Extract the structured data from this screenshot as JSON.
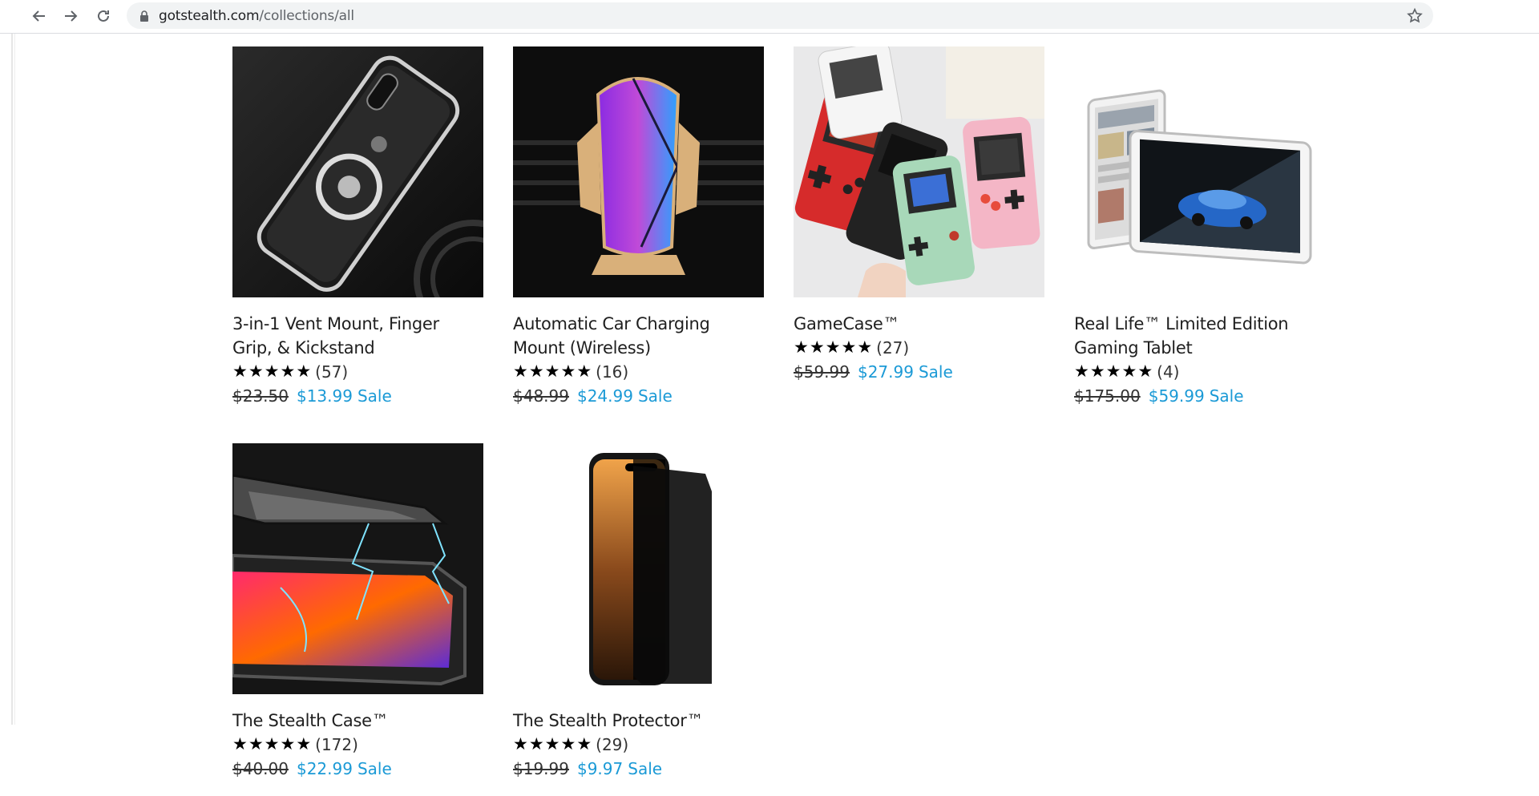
{
  "browser": {
    "url_domain": "gotstealth.com",
    "url_path": "/collections/all",
    "back_icon": "arrow-left-icon",
    "forward_icon": "arrow-right-icon",
    "reload_icon": "reload-icon",
    "bookmark_icon": "star-outline-icon"
  },
  "colors": {
    "sale": "#1b9ad6",
    "stars": "#000000"
  },
  "sale_label": "Sale",
  "products": [
    {
      "title": "3-in-1 Vent Mount, Finger Grip, & Kickstand",
      "rating": 5,
      "reviews": "(57)",
      "old_price": "$23.50",
      "price": "$13.99",
      "image": "phone-ring-holder"
    },
    {
      "title": "Automatic Car Charging Mount (Wireless)",
      "rating": 5,
      "reviews": "(16)",
      "old_price": "$48.99",
      "price": "$24.99",
      "image": "car-charger-mount"
    },
    {
      "title": "GameCase™",
      "rating": 5,
      "reviews": "(27)",
      "old_price": "$59.99",
      "price": "$27.99",
      "image": "game-cases"
    },
    {
      "title": "Real Life™ Limited Edition Gaming Tablet",
      "rating": 5,
      "reviews": "(4)",
      "old_price": "$175.00",
      "price": "$59.99",
      "image": "tablets"
    },
    {
      "title": "The Stealth Case™",
      "rating": 5,
      "reviews": "(172)",
      "old_price": "$40.00",
      "price": "$22.99",
      "image": "magnetic-case"
    },
    {
      "title": "The Stealth Protector™",
      "rating": 5,
      "reviews": "(29)",
      "old_price": "$19.99",
      "price": "$9.97",
      "image": "privacy-screen-protector"
    }
  ]
}
